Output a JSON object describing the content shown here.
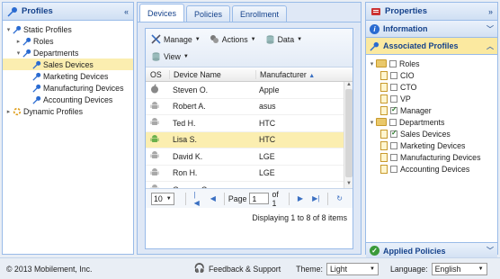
{
  "left": {
    "title": "Profiles",
    "tree": [
      {
        "label": "Static Profiles",
        "depth": 0,
        "arrow": "▾"
      },
      {
        "label": "Roles",
        "depth": 1,
        "arrow": "▸"
      },
      {
        "label": "Departments",
        "depth": 1,
        "arrow": "▾"
      },
      {
        "label": "Sales Devices",
        "depth": 2,
        "arrow": "",
        "selected": true
      },
      {
        "label": "Marketing Devices",
        "depth": 2,
        "arrow": ""
      },
      {
        "label": "Manufacturing Devices",
        "depth": 2,
        "arrow": ""
      },
      {
        "label": "Accounting Devices",
        "depth": 2,
        "arrow": ""
      },
      {
        "label": "Dynamic Profiles",
        "depth": 0,
        "arrow": "▸"
      }
    ]
  },
  "center": {
    "tabs": [
      "Devices",
      "Policies",
      "Enrollment"
    ],
    "toolbar": {
      "manage": "Manage",
      "actions": "Actions",
      "data": "Data",
      "view": "View"
    },
    "columns": {
      "os": "OS",
      "name": "Device Name",
      "manufacturer": "Manufacturer"
    },
    "rows": [
      {
        "os": "apple",
        "name": "Steven O.",
        "manufacturer": "Apple"
      },
      {
        "os": "android",
        "name": "Robert A.",
        "manufacturer": "asus"
      },
      {
        "os": "android",
        "name": "Ted H.",
        "manufacturer": "HTC"
      },
      {
        "os": "android",
        "name": "Lisa S.",
        "manufacturer": "HTC",
        "selected": true
      },
      {
        "os": "android",
        "name": "David K.",
        "manufacturer": "LGE"
      },
      {
        "os": "android",
        "name": "Ron H.",
        "manufacturer": "LGE"
      },
      {
        "os": "android",
        "name": "George C.",
        "manufacturer": "samsung"
      }
    ],
    "pager": {
      "page_size": "10",
      "page_label": "Page",
      "page_value": "1",
      "of_label": "of 1",
      "displaying": "Displaying 1 to 8 of 8 items"
    }
  },
  "right": {
    "properties": "Properties",
    "information": "Information",
    "associated": "Associated Profiles",
    "applied": "Applied Policies",
    "tree": [
      {
        "label": "Roles",
        "type": "folder",
        "depth": 0,
        "arrow": "▾",
        "checked": false
      },
      {
        "label": "CIO",
        "type": "doc",
        "depth": 1,
        "checked": false
      },
      {
        "label": "CTO",
        "type": "doc",
        "depth": 1,
        "checked": false
      },
      {
        "label": "VP",
        "type": "doc",
        "depth": 1,
        "checked": false
      },
      {
        "label": "Manager",
        "type": "doc",
        "depth": 1,
        "checked": true
      },
      {
        "label": "Departments",
        "type": "folder",
        "depth": 0,
        "arrow": "▾",
        "checked": false
      },
      {
        "label": "Sales Devices",
        "type": "doc",
        "depth": 1,
        "checked": true
      },
      {
        "label": "Marketing Devices",
        "type": "doc",
        "depth": 1,
        "checked": false
      },
      {
        "label": "Manufacturing Devices",
        "type": "doc",
        "depth": 1,
        "checked": false
      },
      {
        "label": "Accounting Devices",
        "type": "doc",
        "depth": 1,
        "checked": false
      }
    ]
  },
  "footer": {
    "copyright": "© 2013 Mobilement, Inc.",
    "feedback": "Feedback & Support",
    "theme_label": "Theme:",
    "theme_value": "Light",
    "language_label": "Language:",
    "language_value": "English"
  }
}
